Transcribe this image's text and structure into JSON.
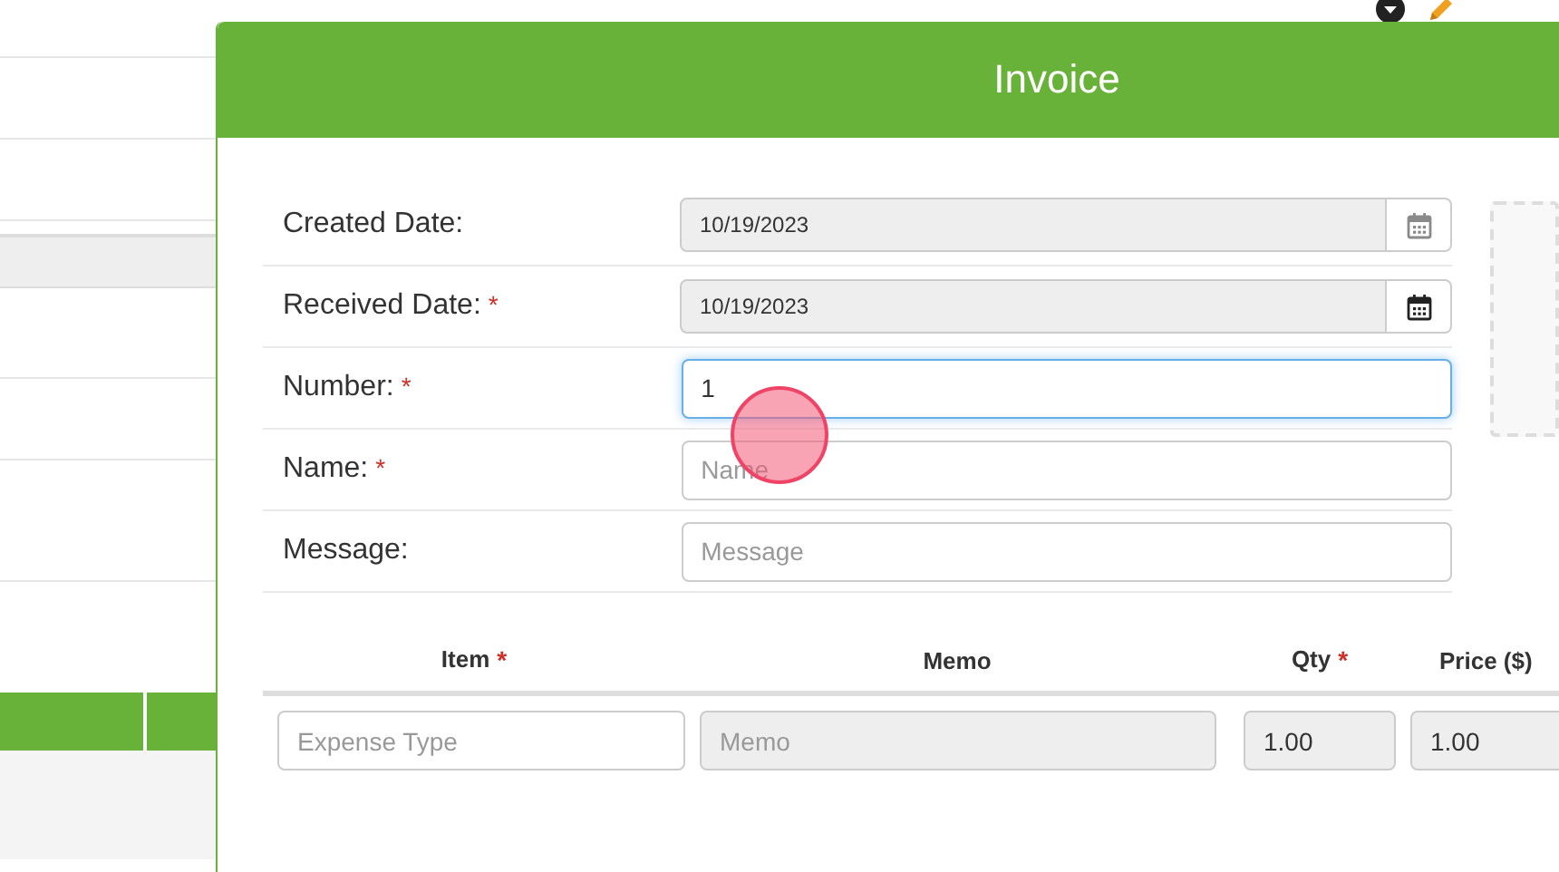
{
  "modal": {
    "title": "Invoice",
    "fields": [
      {
        "label": "Created Date:",
        "kind": "date",
        "value": "10/19/2023",
        "disabled": true,
        "focused": false
      },
      {
        "label": "Received Date:",
        "required_mark": "*",
        "kind": "date",
        "value": "10/19/2023",
        "disabled": false,
        "focused": false
      },
      {
        "label": "Number:",
        "required_mark": "*",
        "kind": "text",
        "value": "1",
        "focused": true
      },
      {
        "label": "Name:",
        "required_mark": "*",
        "kind": "text",
        "placeholder": "Name",
        "focused": false
      },
      {
        "label": "Message:",
        "kind": "text",
        "placeholder": "Message",
        "focused": false
      }
    ],
    "line_items": {
      "columns": [
        {
          "label": "Item",
          "required_mark": "*"
        },
        {
          "label": "Memo"
        },
        {
          "label": "Qty",
          "required_mark": "*"
        },
        {
          "label": "Price ($)"
        }
      ],
      "rows": [
        [
          {
            "placeholder": "Expense Type",
            "disabled": false
          },
          {
            "placeholder": "Memo",
            "disabled": true
          },
          {
            "value": "1.00",
            "disabled": true
          },
          {
            "value": "1.00",
            "disabled": true
          }
        ]
      ]
    }
  }
}
